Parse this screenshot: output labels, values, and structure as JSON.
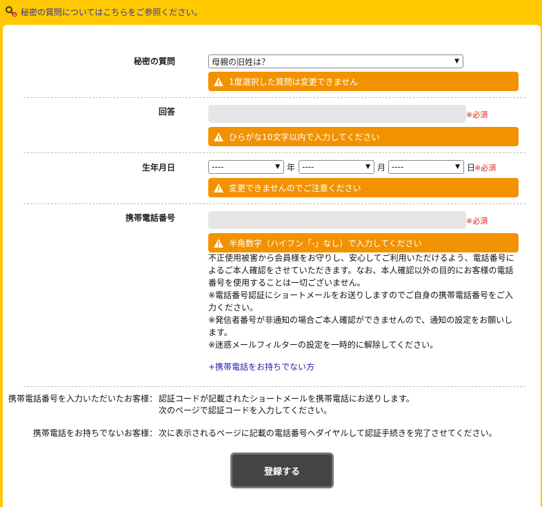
{
  "topbar": {
    "link_text": "秘密の質問についてはこちらをご参照ください。"
  },
  "secret_question": {
    "label": "秘密の質問",
    "selected": "母親の旧姓は？",
    "warning": "1度選択した質問は変更できません"
  },
  "answer": {
    "label": "回答",
    "required": "※必須",
    "warning": "ひらがな10文字以内で入力してください"
  },
  "birthdate": {
    "label": "生年月日",
    "year_value": "----",
    "month_value": "----",
    "day_value": "----",
    "year_unit": "年",
    "month_unit": "月",
    "day_unit": "日",
    "required": "※必須",
    "warning": "変更できませんのでご注意ください"
  },
  "phone": {
    "label": "携帯電話番号",
    "required": "※必須",
    "warning": "半角数字（ハイフン「-」なし）で入力してください",
    "notes": [
      "不正使用被害から会員様をお守りし、安心してご利用いただけるよう、電話番号に",
      "よるご本人確認をさせていただきます。なお、本人確認以外の目的にお客様の電話",
      "番号を使用することは一切ございません。",
      "※電話番号認証にショートメールをお送りしますのでご自身の携帯電話番号をご入",
      "力ください。",
      "※発信者番号が非通知の場合ご本人確認ができませんので、通知の設定をお願いし",
      "ます。",
      "※迷惑メールフィルターの設定を一時的に解除してください。"
    ],
    "no_phone_link": "+携帯電話をお持ちでない方"
  },
  "info": {
    "with_phone_label": "携帯電話番号を入力いただいたお客様：",
    "with_phone_line1": "認証コードが記載されたショートメールを携帯電話にお送りします。",
    "with_phone_line2": "次のページで認証コードを入力してください。",
    "without_phone_label": "携帯電話をお持ちでないお客様：",
    "without_phone_text": "次に表示されるページに記載の電話番号へダイヤルして認証手続きを完了させてください。"
  },
  "submit_label": "登録する",
  "colors": {
    "background": "#ffc800",
    "warning": "#f29200",
    "required": "#e02020",
    "link": "#2222aa",
    "button": "#444444"
  }
}
